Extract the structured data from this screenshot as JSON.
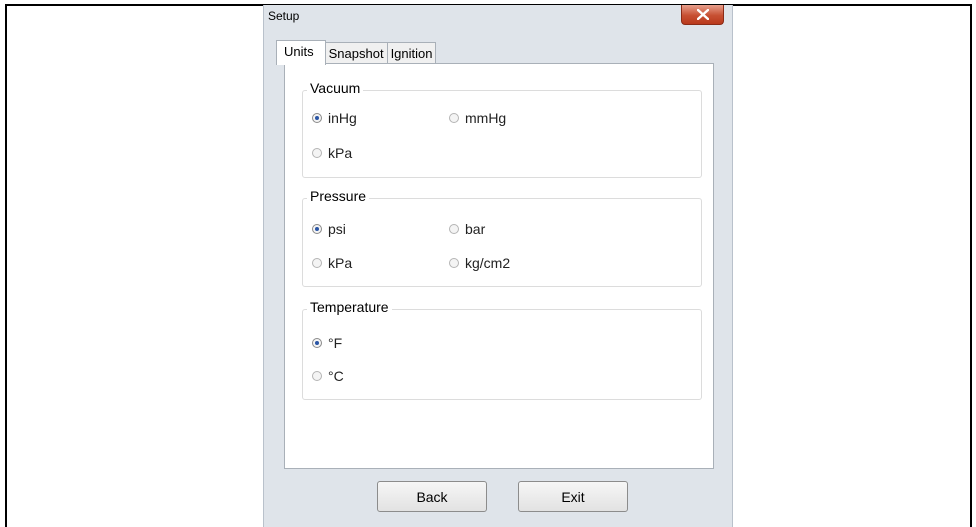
{
  "window": {
    "title": "Setup"
  },
  "tabs": [
    {
      "label": "Units",
      "active": true
    },
    {
      "label": "Snapshot",
      "active": false
    },
    {
      "label": "Ignition",
      "active": false
    }
  ],
  "groups": {
    "vacuum": {
      "title": "Vacuum",
      "options": [
        {
          "label": "inHg",
          "checked": true
        },
        {
          "label": "mmHg",
          "checked": false
        },
        {
          "label": "kPa",
          "checked": false
        }
      ]
    },
    "pressure": {
      "title": "Pressure",
      "options": [
        {
          "label": "psi",
          "checked": true
        },
        {
          "label": "bar",
          "checked": false
        },
        {
          "label": "kPa",
          "checked": false
        },
        {
          "label": "kg/cm2",
          "checked": false
        }
      ]
    },
    "temperature": {
      "title": "Temperature",
      "options": [
        {
          "label": "°F",
          "checked": true
        },
        {
          "label": "°C",
          "checked": false
        }
      ]
    }
  },
  "buttons": {
    "back": "Back",
    "exit": "Exit"
  },
  "colors": {
    "close_button": "#c75033",
    "radio_selected": "#2a55a5",
    "window_bg": "#dfe4ea"
  },
  "icons": {
    "close": "close-icon"
  }
}
